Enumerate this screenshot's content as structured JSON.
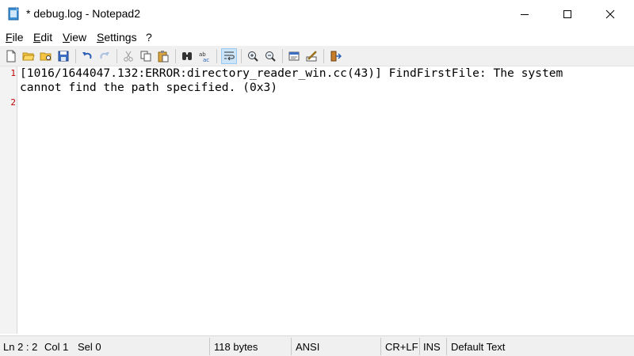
{
  "window": {
    "title": "* debug.log - Notepad2",
    "app_icon": "notepad-icon",
    "controls": [
      "minimize-icon",
      "maximize-icon",
      "close-icon"
    ]
  },
  "menu": {
    "items": [
      "File",
      "Edit",
      "View",
      "Settings",
      "?"
    ]
  },
  "toolbar": {
    "buttons": [
      "new-file-icon",
      "open-file-icon",
      "browse-icon",
      "save-icon",
      "undo-icon",
      "redo-icon",
      "cut-icon",
      "copy-icon",
      "paste-icon",
      "find-icon",
      "replace-icon",
      "word-wrap-icon",
      "zoom-in-icon",
      "zoom-out-icon",
      "scheme-icon",
      "customize-scheme-icon",
      "exit-icon"
    ],
    "active": "word-wrap-icon"
  },
  "editor": {
    "line_numbers": [
      "1",
      "2"
    ],
    "visual_lines": [
      "[1016/1644047.132:ERROR:directory_reader_win.cc(43)] FindFirstFile: The system",
      "cannot find the path specified. (0x3)"
    ],
    "line_number_color": "#c00000"
  },
  "status": {
    "position": "Ln 2 : 2",
    "column": "Col 1",
    "selection": "Sel 0",
    "size": "118 bytes",
    "encoding": "ANSI",
    "line_ending": "CR+LF",
    "mode": "INS",
    "scheme": "Default Text"
  }
}
